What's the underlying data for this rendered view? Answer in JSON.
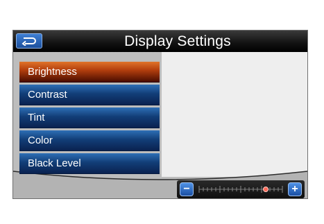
{
  "header": {
    "title": "Display Settings",
    "back_icon": "return-arrow-icon"
  },
  "menu": {
    "selected_index": 0,
    "items": [
      {
        "label": "Brightness"
      },
      {
        "label": "Contrast"
      },
      {
        "label": "Tint"
      },
      {
        "label": "Color"
      },
      {
        "label": "Black Level"
      }
    ]
  },
  "slider": {
    "minus_label": "−",
    "plus_label": "+",
    "level": 0.8
  },
  "colors": {
    "accent_selected": "#b5400e",
    "menu_item": "#123e78",
    "button_blue": "#1b4fa3",
    "thumb": "#ff6a5a"
  }
}
